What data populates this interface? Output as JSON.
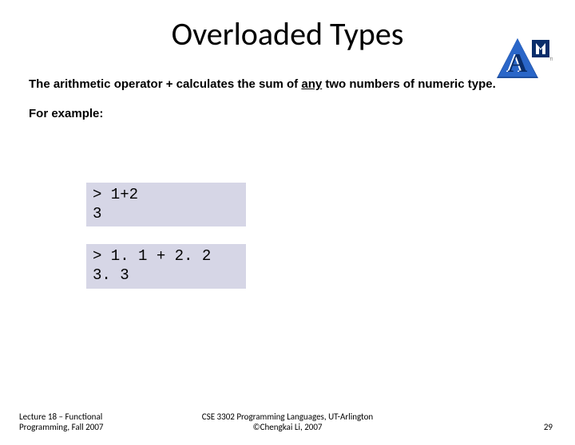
{
  "title": "Overloaded Types",
  "intro_pre": "The arithmetic operator + calculates the sum of ",
  "intro_underlined": "any",
  "intro_post": " two numbers of numeric type.",
  "example_label": "For example:",
  "code1_line1": "> 1+2",
  "code1_line2": "3",
  "code2_line1": "> 1. 1 + 2. 2",
  "code2_line2": "3. 3",
  "footer_left_line1": "Lecture 18 – Functional",
  "footer_left_line2": "Programming, Fall 2007",
  "footer_center_line1": "CSE 3302 Programming Languages, UT-Arlington",
  "footer_center_line2": "©Chengkai Li, 2007",
  "footer_right": "29",
  "logo_letter": "A"
}
